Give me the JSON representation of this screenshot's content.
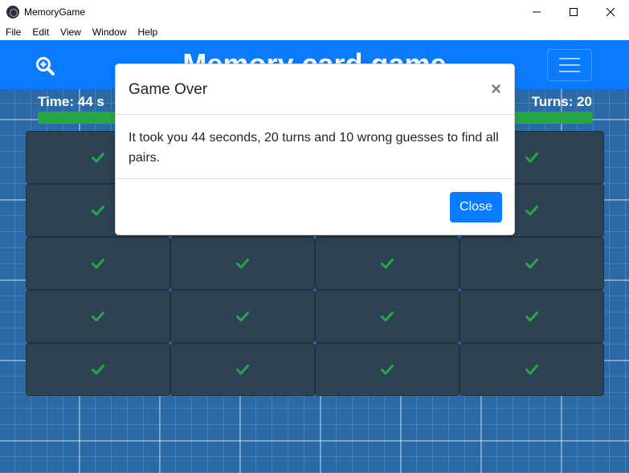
{
  "window": {
    "title": "MemoryGame",
    "controls": [
      "minimize-icon",
      "maximize-icon",
      "close-icon"
    ]
  },
  "menubar": {
    "items": [
      "File",
      "Edit",
      "View",
      "Window",
      "Help"
    ]
  },
  "navbar": {
    "title": "Memory card game",
    "zoom_icon": "zoom-in-icon",
    "menu_icon": "hamburger-icon",
    "accent": "#0a7bff"
  },
  "stats": {
    "time": "Time: 44 s",
    "turns": "Turns: 20",
    "progress_fraction": 1.0,
    "progress_color": "#28a745"
  },
  "board": {
    "rows": 5,
    "columns": 4,
    "cards": [
      "matched",
      "matched",
      "matched",
      "matched",
      "matched",
      "matched",
      "matched",
      "matched",
      "matched",
      "matched",
      "matched",
      "matched",
      "matched",
      "matched",
      "matched",
      "matched",
      "matched",
      "matched",
      "matched",
      "matched"
    ],
    "check_color": "#28a745",
    "card_color": "#2d4253"
  },
  "modal": {
    "title": "Game Over",
    "close_symbol": "×",
    "body": "It took you 44 seconds, 20 turns and 10 wrong guesses to find all pairs.",
    "close_label": "Close"
  }
}
